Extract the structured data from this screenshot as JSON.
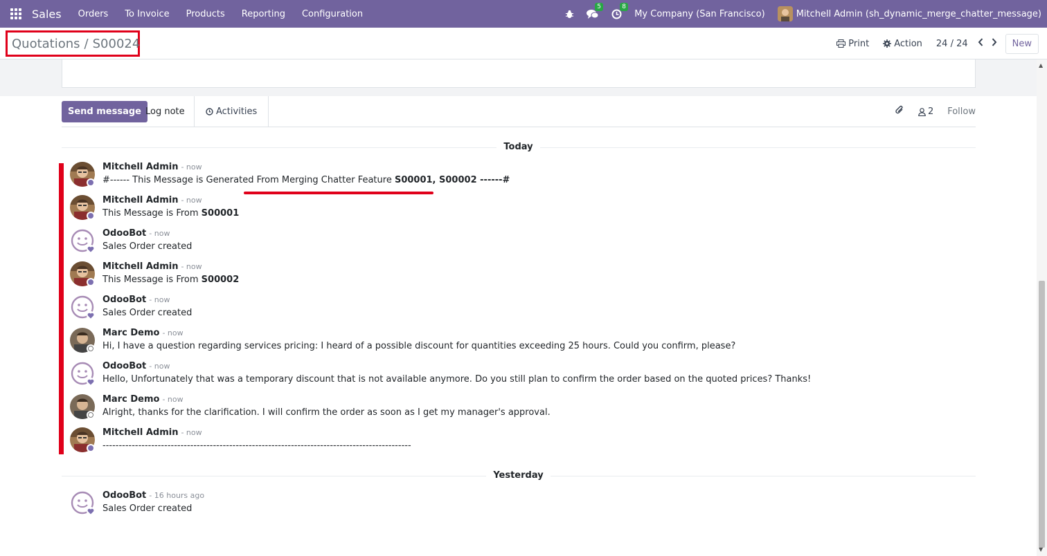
{
  "topbar": {
    "app_name": "Sales",
    "menu": [
      "Orders",
      "To Invoice",
      "Products",
      "Reporting",
      "Configuration"
    ],
    "messages_count": "5",
    "activities_count": "8",
    "company": "My Company (San Francisco)",
    "user": "Mitchell Admin (sh_dynamic_merge_chatter_message)"
  },
  "breadcrumb": {
    "parent": "Quotations",
    "separator": "/",
    "current": "S00024"
  },
  "control": {
    "print": "Print",
    "action": "Action",
    "pager": "24 / 24",
    "new": "New"
  },
  "chatter": {
    "send_message": "Send message",
    "log_note": "Log note",
    "activities": "Activities",
    "followers_count": "2",
    "follow": "Follow"
  },
  "groups": {
    "today": "Today",
    "yesterday": "Yesterday"
  },
  "messages": [
    {
      "author": "Mitchell Admin",
      "time": "- now",
      "pre": "#------ This Message is Generated From Merging Chatter Feature ",
      "bold": "S00001, S00002",
      "post": " ------#"
    },
    {
      "author": "Mitchell Admin",
      "time": "- now",
      "pre": "This Message is From ",
      "bold": "S00001",
      "post": ""
    },
    {
      "author": "OdooBot",
      "time": "- now",
      "pre": "Sales Order created",
      "bold": "",
      "post": ""
    },
    {
      "author": "Mitchell Admin",
      "time": "- now",
      "pre": "This Message is From ",
      "bold": "S00002",
      "post": ""
    },
    {
      "author": "OdooBot",
      "time": "- now",
      "pre": "Sales Order created",
      "bold": "",
      "post": ""
    },
    {
      "author": "Marc Demo",
      "time": "- now",
      "pre": "Hi, I have a question regarding services pricing: I heard of a possible discount for quantities exceeding 25 hours. Could you confirm, please?",
      "bold": "",
      "post": ""
    },
    {
      "author": "OdooBot",
      "time": "- now",
      "pre": "Hello, Unfortunately that was a temporary discount that is not available anymore. Do you still plan to confirm the order based on the quoted prices? Thanks!",
      "bold": "",
      "post": ""
    },
    {
      "author": "Marc Demo",
      "time": "- now",
      "pre": "Alright, thanks for the clarification. I will confirm the order as soon as I get my manager's approval.",
      "bold": "",
      "post": ""
    },
    {
      "author": "Mitchell Admin",
      "time": "- now",
      "pre": "-----------------------------------------------------------------------------------------------",
      "bold": "",
      "post": ""
    },
    {
      "author": "OdooBot",
      "time": "- 16 hours ago",
      "pre": "Sales Order created",
      "bold": "",
      "post": ""
    }
  ],
  "colors": {
    "brand": "#71639e",
    "highlight": "#e0001a",
    "badge": "#28a745"
  }
}
